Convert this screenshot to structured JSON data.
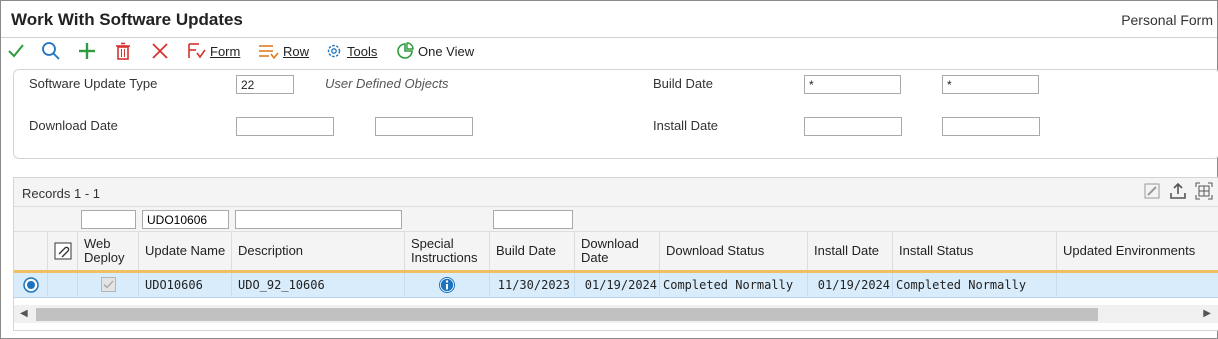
{
  "window": {
    "title": "Work With Software Updates",
    "personal_form": "Personal Form"
  },
  "toolbar": {
    "form_label": "Form",
    "row_label": "Row",
    "tools_label": "Tools",
    "oneview_label": "One View"
  },
  "criteria": {
    "software_update_type_label": "Software Update Type",
    "software_update_type_value": "22",
    "software_update_type_desc": "User Defined Objects",
    "build_date_label": "Build Date",
    "build_date_from": "*",
    "build_date_to": "*",
    "download_date_label": "Download Date",
    "install_date_label": "Install Date"
  },
  "grid": {
    "records_label": "Records 1 - 1",
    "qbe_update_name": "UDO10606",
    "columns": {
      "web_deploy": "Web Deploy",
      "update_name": "Update Name",
      "description": "Description",
      "special_instructions": "Special Instructions",
      "build_date": "Build Date",
      "download_date": "Download Date",
      "download_status": "Download Status",
      "install_date": "Install Date",
      "install_status": "Install Status",
      "updated_environments": "Updated Environments"
    },
    "rows": [
      {
        "update_name": "UDO10606",
        "description": "UDO_92_10606",
        "build_date": "11/30/2023",
        "download_date": "01/19/2024",
        "download_status": "Completed Normally",
        "install_date": "01/19/2024",
        "install_status": "Completed Normally",
        "updated_environments": ""
      }
    ]
  },
  "colors": {
    "accent_blue": "#1e73be",
    "green": "#2e9b3c",
    "red": "#d6332e",
    "orange": "#e07b20",
    "row_selected": "#d9ecfb"
  }
}
